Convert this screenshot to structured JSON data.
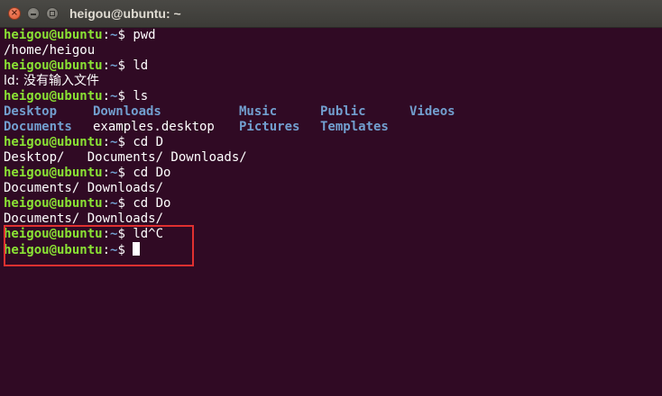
{
  "window": {
    "title": "heigou@ubuntu: ~",
    "buttons": {
      "close_icon": "×",
      "minimize_icon": "minimize",
      "maximize_icon": "maximize"
    }
  },
  "colors": {
    "background": "#300a24",
    "prompt_user": "#8ae234",
    "prompt_path": "#729fcf",
    "directory": "#729fcf",
    "text": "#ffffff",
    "highlight_box": "#e03030"
  },
  "terminal": {
    "prompt_user": "heigou@ubuntu",
    "prompt_sep": ":",
    "prompt_path": "~",
    "prompt_symbol": "$ ",
    "lines": [
      {
        "type": "cmd",
        "command": "pwd"
      },
      {
        "type": "out",
        "text": "/home/heigou"
      },
      {
        "type": "cmd",
        "command": "ld"
      },
      {
        "type": "out",
        "text": "ld: 没有输入文件"
      },
      {
        "type": "cmd",
        "command": "ls"
      },
      {
        "type": "ls",
        "cells": [
          {
            "text": "Desktop",
            "kind": "dir"
          },
          {
            "text": "Downloads",
            "kind": "dir"
          },
          {
            "text": "Music",
            "kind": "dir"
          },
          {
            "text": "Public",
            "kind": "dir"
          },
          {
            "text": "Videos",
            "kind": "dir"
          }
        ]
      },
      {
        "type": "ls",
        "cells": [
          {
            "text": "Documents",
            "kind": "dir"
          },
          {
            "text": "examples.desktop",
            "kind": "file"
          },
          {
            "text": "Pictures",
            "kind": "dir"
          },
          {
            "text": "Templates",
            "kind": "dir"
          }
        ]
      },
      {
        "type": "cmd",
        "command": "cd D"
      },
      {
        "type": "out",
        "text": "Desktop/   Documents/ Downloads/"
      },
      {
        "type": "cmd",
        "command": "cd Do"
      },
      {
        "type": "out",
        "text": "Documents/ Downloads/"
      },
      {
        "type": "cmd",
        "command": "cd Do"
      },
      {
        "type": "out",
        "text": "Documents/ Downloads/"
      },
      {
        "type": "cmd",
        "command": "ld^C"
      },
      {
        "type": "cmd",
        "command": "",
        "cursor": true
      }
    ]
  }
}
